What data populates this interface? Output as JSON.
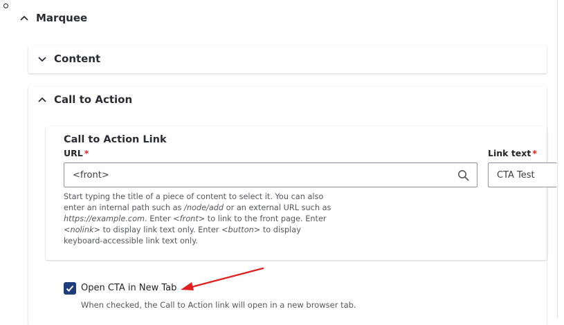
{
  "marquee": {
    "title": "Marquee"
  },
  "content_section": {
    "title": "Content"
  },
  "cta_section": {
    "title": "Call to Action",
    "link_group_title": "Call to Action Link",
    "url_label": "URL",
    "required_mark": "*",
    "url_value": "<front>",
    "link_text_label": "Link text",
    "link_text_value": "CTA Test",
    "help": {
      "p1": "Start typing the title of a piece of content to select it. You can also enter an internal path such as ",
      "e1": "/node/add",
      "p2": " or an external URL such as ",
      "e2": "https://example.com",
      "p3": ". Enter ",
      "e3": "<front>",
      "p4": " to link to the front page. Enter ",
      "e4": "<nolink>",
      "p5": " to display link text only. Enter ",
      "e5": "<button>",
      "p6": " to display keyboard-accessible link text only."
    },
    "new_tab_label": "Open CTA in New Tab",
    "new_tab_checked": true,
    "new_tab_help": "When checked, the Call to Action link will open in a new browser tab."
  },
  "colors": {
    "checkbox": "#1f3d7a",
    "required": "#d72222",
    "arrow": "#e02020"
  },
  "icons": [
    "chevron-up-icon",
    "chevron-down-icon",
    "search-icon",
    "checkmark-icon",
    "annotation-arrow"
  ]
}
